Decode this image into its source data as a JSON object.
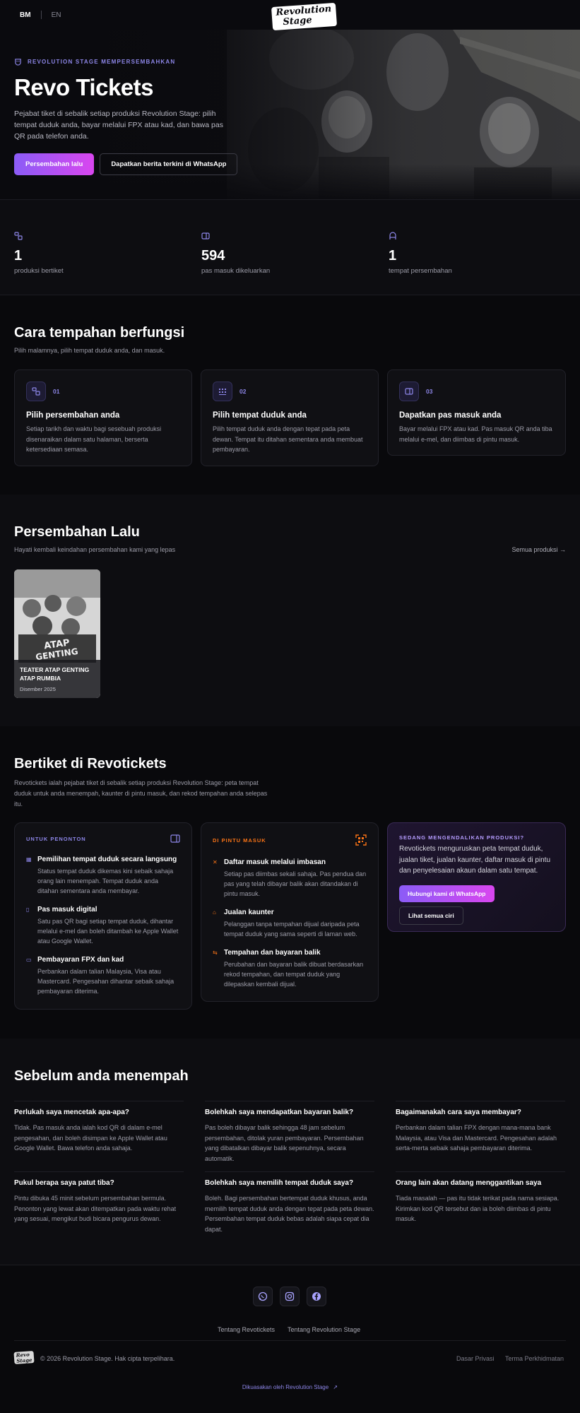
{
  "topbar": {
    "lang_active": "BM",
    "lang_other": "EN",
    "logo_text": "Revolution Stage"
  },
  "hero": {
    "eyebrow": "REVOLUTION STAGE MEMPERSEMBAHKAN",
    "title": "Revo Tickets",
    "subtitle": "Pejabat tiket di sebalik setiap produksi Revolution Stage: pilih tempat duduk anda, bayar melalui FPX atau kad, dan bawa pas QR pada telefon anda.",
    "btn_primary": "Persembahan lalu",
    "btn_secondary": "Dapatkan berita terkini di WhatsApp"
  },
  "stats": [
    {
      "icon": "ticket-icon",
      "value": "1",
      "label": "produksi bertiket"
    },
    {
      "icon": "pass-icon",
      "value": "594",
      "label": "pas masuk dikeluarkan"
    },
    {
      "icon": "venue-icon",
      "value": "1",
      "label": "tempat persembahan"
    }
  ],
  "how": {
    "title": "Cara tempahan berfungsi",
    "subtitle": "Pilih malamnya, pilih tempat duduk anda, dan masuk.",
    "steps": [
      {
        "num": "01",
        "title": "Pilih persembahan anda",
        "text": "Setiap tarikh dan waktu bagi sesebuah produksi disenaraikan dalam satu halaman, berserta ketersediaan semasa."
      },
      {
        "num": "02",
        "title": "Pilih tempat duduk anda",
        "text": "Pilih tempat duduk anda dengan tepat pada peta dewan. Tempat itu ditahan sementara anda membuat pembayaran."
      },
      {
        "num": "03",
        "title": "Dapatkan pas masuk anda",
        "text": "Bayar melalui FPX atau kad. Pas masuk QR anda tiba melalui e-mel, dan diimbas di pintu masuk."
      }
    ]
  },
  "past": {
    "title": "Persembahan Lalu",
    "subtitle": "Hayati kembali keindahan persembahan kami yang lepas",
    "see_all": "Semua produksi →",
    "shows": [
      {
        "title": "TEATER ATAP GENTING ATAP RUMBIA",
        "date": "Disember 2025",
        "poster_text": "ATAP GENTING ATAP RUMBIA"
      }
    ]
  },
  "bertiket": {
    "title": "Bertiket di Revotickets",
    "subtitle": "Revotickets ialah pejabat tiket di sebalik setiap produksi Revolution Stage: peta tempat duduk untuk anda menempah, kaunter di pintu masuk, dan rekod tempahan anda selepas itu.",
    "audience": {
      "label": "UNTUK PENONTON",
      "items": [
        {
          "title": "Pemilihan tempat duduk secara langsung",
          "text": "Status tempat duduk dikemas kini sebaik sahaja orang lain menempah. Tempat duduk anda ditahan sementara anda membayar."
        },
        {
          "title": "Pas masuk digital",
          "text": "Satu pas QR bagi setiap tempat duduk, dihantar melalui e-mel dan boleh ditambah ke Apple Wallet atau Google Wallet."
        },
        {
          "title": "Pembayaran FPX dan kad",
          "text": "Perbankan dalam talian Malaysia, Visa atau Mastercard. Pengesahan dihantar sebaik sahaja pembayaran diterima."
        }
      ]
    },
    "door": {
      "label": "DI PINTU MASUK",
      "items": [
        {
          "title": "Daftar masuk melalui imbasan",
          "text": "Setiap pas diimbas sekali sahaja. Pas pendua dan pas yang telah dibayar balik akan ditandakan di pintu masuk."
        },
        {
          "title": "Jualan kaunter",
          "text": "Pelanggan tanpa tempahan dijual daripada peta tempat duduk yang sama seperti di laman web."
        },
        {
          "title": "Tempahan dan bayaran balik",
          "text": "Perubahan dan bayaran balik dibuat berdasarkan rekod tempahan, dan tempat duduk yang dilepaskan kembali dijual."
        }
      ]
    },
    "producer": {
      "label": "SEDANG MENGENDALIKAN PRODUKSI?",
      "text": "Revotickets menguruskan peta tempat duduk, jualan tiket, jualan kaunter, daftar masuk di pintu dan penyelesaian akaun dalam satu tempat.",
      "btn_primary": "Hubungi kami di WhatsApp",
      "btn_secondary": "Lihat semua ciri"
    }
  },
  "faq": {
    "title": "Sebelum anda menempah",
    "items": [
      {
        "q": "Perlukah saya mencetak apa-apa?",
        "a": "Tidak. Pas masuk anda ialah kod QR di dalam e-mel pengesahan, dan boleh disimpan ke Apple Wallet atau Google Wallet. Bawa telefon anda sahaja."
      },
      {
        "q": "Bolehkah saya mendapatkan bayaran balik?",
        "a": "Pas boleh dibayar balik sehingga 48 jam sebelum persembahan, ditolak yuran pembayaran. Persembahan yang dibatalkan dibayar balik sepenuhnya, secara automatik."
      },
      {
        "q": "Bagaimanakah cara saya membayar?",
        "a": "Perbankan dalam talian FPX dengan mana-mana bank Malaysia, atau Visa dan Mastercard. Pengesahan adalah serta-merta sebaik sahaja pembayaran diterima."
      },
      {
        "q": "Pukul berapa saya patut tiba?",
        "a": "Pintu dibuka 45 minit sebelum persembahan bermula. Penonton yang lewat akan ditempatkan pada waktu rehat yang sesuai, mengikut budi bicara pengurus dewan."
      },
      {
        "q": "Bolehkah saya memilih tempat duduk saya?",
        "a": "Boleh. Bagi persembahan bertempat duduk khusus, anda memilih tempat duduk anda dengan tepat pada peta dewan. Persembahan tempat duduk bebas adalah siapa cepat dia dapat."
      },
      {
        "q": "Orang lain akan datang menggantikan saya",
        "a": "Tiada masalah — pas itu tidak terikat pada nama sesiapa. Kirimkan kod QR tersebut dan ia boleh diimbas di pintu masuk."
      }
    ]
  },
  "footer": {
    "social": [
      "whatsapp-icon",
      "instagram-icon",
      "facebook-icon"
    ],
    "link_1": "Tentang Revotickets",
    "link_2": "Tentang Revolution Stage",
    "copyright": "© 2026 Revolution Stage. Hak cipta terpelihara.",
    "privacy": "Dasar Privasi",
    "terms": "Terma Perkhidmatan",
    "powered": "Dikuasakan oleh Revolution Stage"
  },
  "colors": {
    "accent": "#8d86e8",
    "grad_start": "#8b5cf6",
    "grad_end": "#d946ef",
    "door_accent": "#f97316"
  }
}
